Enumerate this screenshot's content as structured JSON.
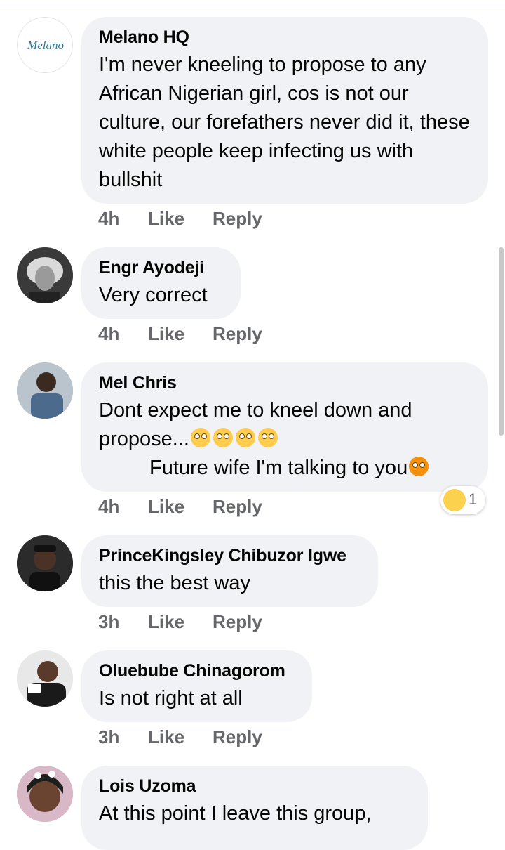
{
  "comments": [
    {
      "author": "Melano HQ",
      "avatar_label": "Melano",
      "text": "I'm never kneeling to propose to any African Nigerian girl, cos is not our culture, our forefathers never did it, these white people keep infecting us with bullshit",
      "time": "4h",
      "like": "Like",
      "reply": "Reply"
    },
    {
      "author": "Engr Ayodeji",
      "text": "Very correct",
      "time": "4h",
      "like": "Like",
      "reply": "Reply"
    },
    {
      "author": "Mel Chris",
      "text_line1": "Dont expect me to kneel down and",
      "text_line2": "propose...",
      "text_line3": "Future wife I'm talking to you",
      "emojis": [
        "face-with-rolling-eyes",
        "face-with-rolling-eyes",
        "face-with-rolling-eyes",
        "face-with-rolling-eyes",
        "hot-face"
      ],
      "reaction_icon": "laughing-face",
      "reaction_count": "1",
      "time": "4h",
      "like": "Like",
      "reply": "Reply"
    },
    {
      "author": "PrinceKingsley Chibuzor Igwe",
      "text": "this the best way",
      "time": "3h",
      "like": "Like",
      "reply": "Reply"
    },
    {
      "author": "Oluebube Chinagorom",
      "text": "Is not right at all",
      "time": "3h",
      "like": "Like",
      "reply": "Reply"
    },
    {
      "author": "Lois Uzoma",
      "text": "At this point I leave this group,"
    }
  ],
  "colors": {
    "bubble": "#f0f2f5",
    "meta": "#65676b",
    "text": "#050505"
  }
}
